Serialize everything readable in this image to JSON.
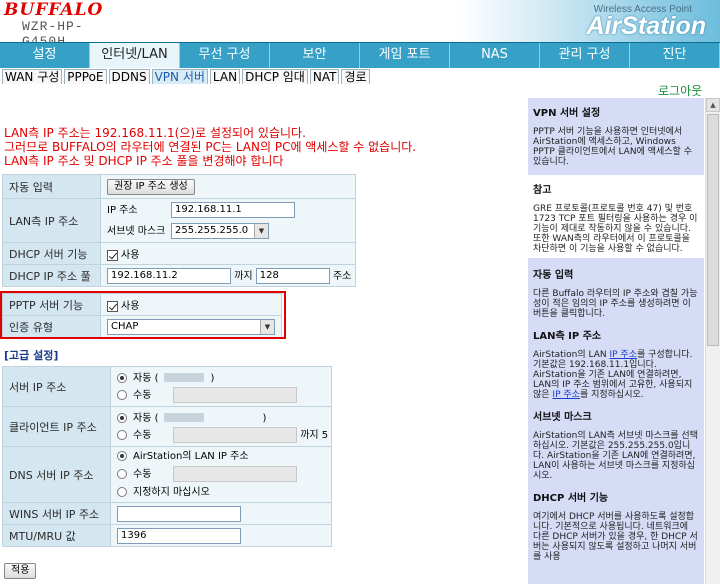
{
  "header": {
    "brand": "BUFFALO",
    "model": "WZR-HP-G450H",
    "product_tag": "Wireless Access Point",
    "product_name": "AirStation"
  },
  "nav": {
    "tabs": [
      {
        "label": "설정",
        "active": false
      },
      {
        "label": "인터넷/LAN",
        "active": true
      },
      {
        "label": "무선 구성",
        "active": false
      },
      {
        "label": "보안",
        "active": false
      },
      {
        "label": "게임 포트",
        "active": false
      },
      {
        "label": "NAS",
        "active": false
      },
      {
        "label": "관리 구성",
        "active": false
      },
      {
        "label": "진단",
        "active": false
      }
    ]
  },
  "subnav": {
    "tabs": [
      {
        "label": "WAN 구성",
        "active": false
      },
      {
        "label": "PPPoE",
        "active": false
      },
      {
        "label": "DDNS",
        "active": false
      },
      {
        "label": "VPN 서버",
        "active": true
      },
      {
        "label": "LAN",
        "active": false
      },
      {
        "label": "DHCP 임대",
        "active": false
      },
      {
        "label": "NAT",
        "active": false
      },
      {
        "label": "경로",
        "active": false
      }
    ],
    "logout": "로그아웃"
  },
  "notice": [
    "LAN측 IP 주소는 192.168.11.1(으)로 설정되어 있습니다.",
    "그러므로 BUFFALO의 라우터에 연결된 PC는 LAN의 PC에 액세스할 수 없습니다.",
    "LAN측 IP 주소 및 DHCP IP 주소 풀을 변경해야 합니다"
  ],
  "form": {
    "auto_input_label": "자동 입력",
    "auto_input_button": "권장 IP 주소 생성",
    "lan_ip_label": "LAN측 IP 주소",
    "ip_addr_label": "IP 주소",
    "ip_addr_value": "192.168.11.1",
    "subnet_label": "서브넷 마스크",
    "subnet_value": "255.255.255.0",
    "dhcp_server_label": "DHCP 서버 기능",
    "dhcp_server_check": "사용",
    "dhcp_pool_label": "DHCP IP 주소 풀",
    "dhcp_pool_start": "192.168.11.2",
    "dhcp_pool_to": "까지",
    "dhcp_pool_count": "128",
    "dhcp_pool_unit": "주소",
    "pptp_label": "PPTP 서버 기능",
    "pptp_check": "사용",
    "auth_label": "인증 유형",
    "auth_value": "CHAP"
  },
  "advanced": {
    "title": "[고급 설정]",
    "server_ip_label": "서버 IP 주소",
    "client_ip_label": "클라이언트 IP 주소",
    "dns_label": "DNS 서버 IP 주소",
    "wins_label": "WINS 서버 IP 주소",
    "mtu_label": "MTU/MRU 값",
    "auto_label": "자동 (",
    "manual_label": "수동",
    "until_5": "까지 5",
    "dns_opt1": "AirStation의 LAN IP 주소",
    "dns_opt2": "수동",
    "dns_opt3": "지정하지 마십시오",
    "mtu_value": "1396",
    "apply": "적용"
  },
  "sidebar": {
    "title": "VPN 서버 설정",
    "intro": "PPTP 서버 기능을 사용하면 인터넷에서 AirStation에 액세스하고, Windows PPTP 클라이언트에서 LAN에 액세스할 수 있습니다.",
    "ref_title": "참고",
    "ref_text": "GRE 프로토콜(프로토콜 번호 47) 및 번호 1723 TCP 포트 필터링을 사용하는 경우 이 기능이 제대로 작동하지 않을 수 있습니다. 또한 WAN측의 라우터에서 이 프로토콜을 차단하면 이 기능을 사용할 수 없습니다.",
    "auto_title": "자동 입력",
    "auto_text": "다른 Buffalo 라우터의 IP 주소와 겹칠 가능성이 적은 임의의 IP 주소를 생성하려면 이 버튼을 클릭합니다.",
    "lanip_title": "LAN측 IP 주소",
    "lanip_text1": "AirStation의 LAN ",
    "lanip_link1": "IP 주소",
    "lanip_text2": "를 구성합니다. 기본값은 192.168.11.1입니다. AirStation을 기존 LAN에 연결하려면, LAN의 IP 주소 범위에서 고유한, 사용되지 않은 ",
    "lanip_link2": "IP 주소",
    "lanip_text3": "를 지정하십시오.",
    "subnet_title": "서브넷 마스크",
    "subnet_text": "AirStation의 LAN측 서브넷 마스크를 선택하십시오. 기본값은 255.255.255.0입니다. AirStation을 기존 LAN에 연결하려면, LAN이 사용하는 서브넷 마스크를 지정하십시오.",
    "dhcp_title": "DHCP 서버 기능",
    "dhcp_text": "여기에서 DHCP 서버를 사용하도록 설정합니다. 기본적으로 사용됩니다. 네트워크에 다른 DHCP 서버가 있을 경우, 한 DHCP 서버는 사용되지 않도록 설정하고 나머지 서버를 사용"
  }
}
